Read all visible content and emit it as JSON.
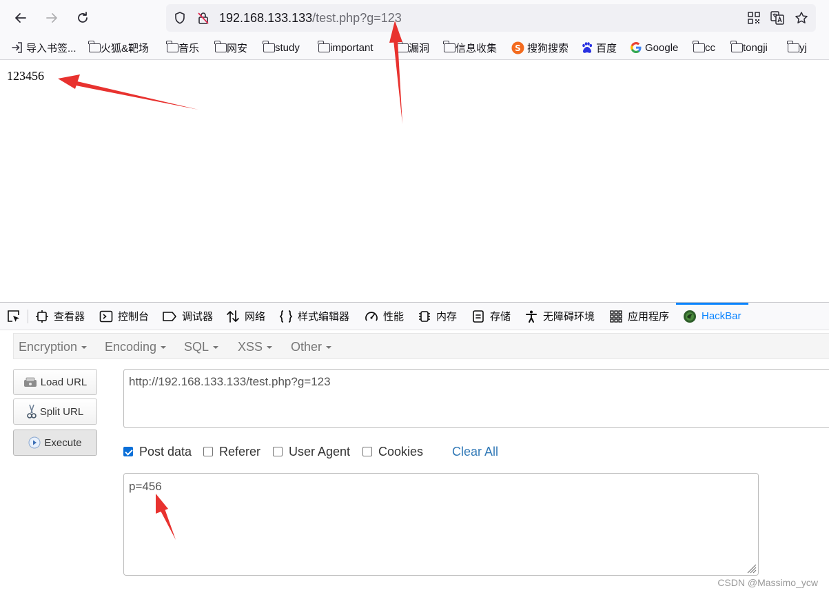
{
  "browser": {
    "url_host": "192.168.133.133",
    "url_path": "/test.php?g=123",
    "bookmarks": [
      {
        "label": "导入书签...",
        "icon": "import-icon"
      },
      {
        "label": "火狐&靶场",
        "icon": "folder-icon"
      },
      {
        "label": "音乐",
        "icon": "folder-icon"
      },
      {
        "label": "网安",
        "icon": "folder-icon"
      },
      {
        "label": "study",
        "icon": "folder-icon"
      },
      {
        "label": "important",
        "icon": "folder-icon"
      },
      {
        "label": "漏洞",
        "icon": "folder-icon"
      },
      {
        "label": "信息收集",
        "icon": "folder-icon"
      },
      {
        "label": "搜狗搜索",
        "icon": "sogou-icon"
      },
      {
        "label": "百度",
        "icon": "baidu-icon"
      },
      {
        "label": "Google",
        "icon": "google-icon"
      },
      {
        "label": "cc",
        "icon": "folder-icon"
      },
      {
        "label": "tongji",
        "icon": "folder-icon"
      },
      {
        "label": "yj",
        "icon": "folder-icon"
      }
    ]
  },
  "page": {
    "output": "123456"
  },
  "devtools": {
    "tabs": [
      {
        "label": "查看器",
        "icon": "inspector-icon"
      },
      {
        "label": "控制台",
        "icon": "console-icon"
      },
      {
        "label": "调试器",
        "icon": "debugger-icon"
      },
      {
        "label": "网络",
        "icon": "network-icon"
      },
      {
        "label": "样式编辑器",
        "icon": "style-editor-icon"
      },
      {
        "label": "性能",
        "icon": "performance-icon"
      },
      {
        "label": "内存",
        "icon": "memory-icon"
      },
      {
        "label": "存储",
        "icon": "storage-icon"
      },
      {
        "label": "无障碍环境",
        "icon": "accessibility-icon"
      },
      {
        "label": "应用程序",
        "icon": "application-icon"
      },
      {
        "label": "HackBar",
        "icon": "hackbar-icon",
        "active": true
      }
    ]
  },
  "hackbar": {
    "menus": [
      "Encryption",
      "Encoding",
      "SQL",
      "XSS",
      "Other"
    ],
    "buttons": {
      "load_url": "Load URL",
      "split_url": "Split URL",
      "execute": "Execute"
    },
    "url_value": "http://192.168.133.133/test.php?g=123",
    "options": {
      "post_data": {
        "label": "Post data",
        "checked": true
      },
      "referer": {
        "label": "Referer",
        "checked": false
      },
      "user_agent": {
        "label": "User Agent",
        "checked": false
      },
      "cookies": {
        "label": "Cookies",
        "checked": false
      }
    },
    "clear_all": "Clear All",
    "post_value": "p=456"
  },
  "watermark": "CSDN @Massimo_ycw",
  "colors": {
    "accent": "#0a84ff",
    "annotation_arrow": "#e8322f",
    "link": "#337ab7"
  }
}
